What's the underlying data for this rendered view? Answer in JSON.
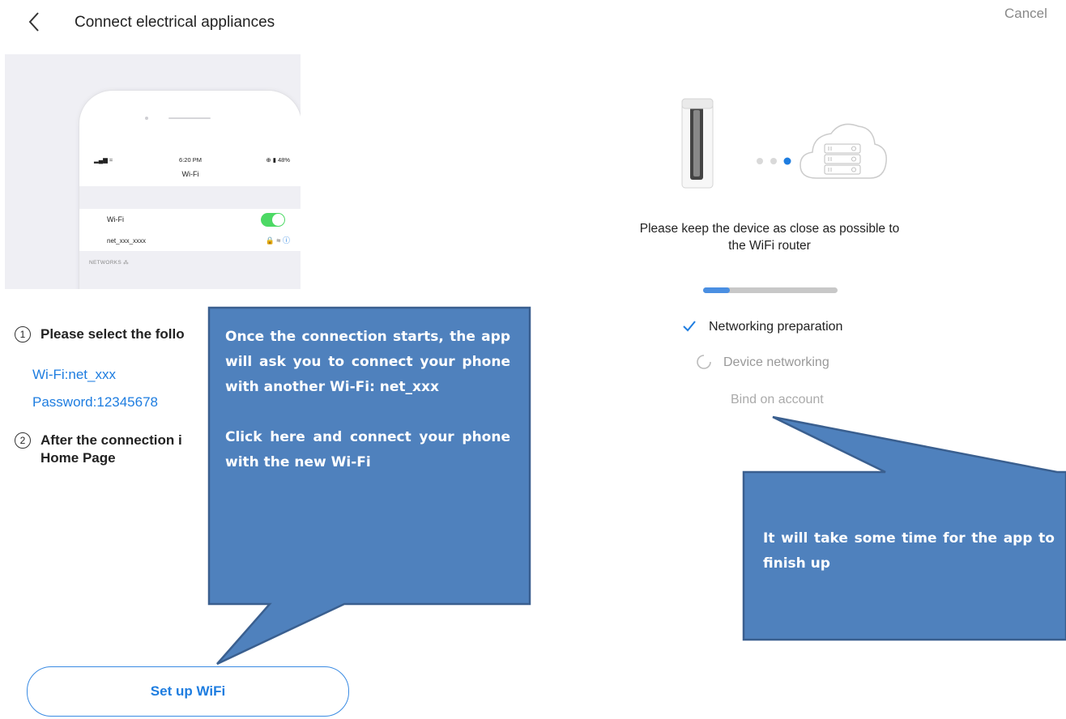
{
  "left_screen": {
    "header": {
      "title": "Connect electrical appliances"
    },
    "illustration": {
      "status_time": "6:20 PM",
      "status_right": "⊕ ▮ 48%",
      "screen_title": "Wi-Fi",
      "wifi_row_label": "Wi-Fi",
      "network_name": "net_xxx_xxxx",
      "networks_label": "NETWORKS"
    },
    "steps": {
      "step1_number": "1",
      "step1_text": "Please select the follo",
      "wifi": "Wi-Fi:net_xxx",
      "password": "Password:12345678",
      "step2_number": "2",
      "step2_line1": "After the connection i",
      "step2_line2": "Home Page"
    },
    "setup_button": "Set up WiFi"
  },
  "right_screen": {
    "cancel": "Cancel",
    "instruction": "Please keep the device as close as possible to the WiFi router",
    "progress": 0.2,
    "steps": [
      {
        "label": "Networking preparation",
        "state": "done"
      },
      {
        "label": "Device networking",
        "state": "in-progress"
      },
      {
        "label": "Bind on account",
        "state": "pending"
      }
    ]
  },
  "callouts": {
    "left_para1": "Once the connection starts, the app will ask you to connect your phone with another Wi-Fi: net_xxx",
    "left_para2": "Click here and connect your phone with the new Wi-Fi",
    "right": "It will take some time for the app to finish up"
  },
  "colors": {
    "accent_blue": "#1e7de0",
    "callout_fill": "#4f81bd",
    "callout_border": "#3a5f8f",
    "toggle_green": "#4cd964"
  }
}
